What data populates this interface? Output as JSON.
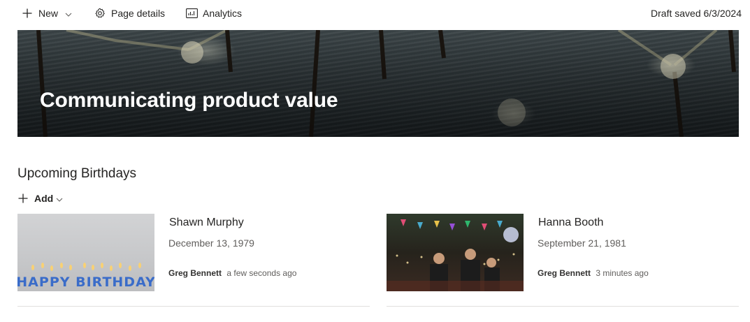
{
  "commandbar": {
    "new_label": "New",
    "page_details_label": "Page details",
    "analytics_label": "Analytics",
    "draft_status": "Draft saved 6/3/2024"
  },
  "hero": {
    "title": "Communicating product value"
  },
  "birthdays": {
    "section_title": "Upcoming Birthdays",
    "add_label": "Add",
    "items": [
      {
        "name": "Shawn Murphy",
        "date": "December 13, 1979",
        "author": "Greg Bennett",
        "time": "a few seconds ago",
        "image_text": "HAPPY BIRTHDAY"
      },
      {
        "name": "Hanna Booth",
        "date": "September 21, 1981",
        "author": "Greg Bennett",
        "time": "3 minutes ago"
      }
    ]
  },
  "icons": {
    "new": "plus-icon",
    "new_menu": "chevron-down-icon",
    "page_details": "gear-icon",
    "analytics": "analytics-icon",
    "add": "plus-icon",
    "add_menu": "chevron-down-icon"
  },
  "colors": {
    "text": "#252423",
    "secondary_text": "#605e5c",
    "divider": "#e1dfdd",
    "hero_title": "#ffffff"
  }
}
